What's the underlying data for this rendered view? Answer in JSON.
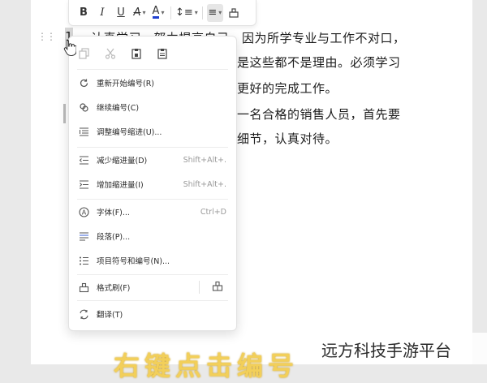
{
  "toolbar": {
    "items": [
      {
        "icon": "bold-icon",
        "glyph": "B"
      },
      {
        "icon": "italic-icon",
        "glyph": "I"
      },
      {
        "icon": "underline-icon",
        "glyph": "U"
      },
      {
        "icon": "highlight-icon",
        "glyph": "A"
      },
      {
        "icon": "font-color-icon",
        "glyph": "A"
      },
      {
        "icon": "line-spacing-icon",
        "glyph": "≡"
      },
      {
        "icon": "align-icon",
        "glyph": "≡"
      },
      {
        "icon": "format-painter-icon",
        "glyph": "⌂"
      }
    ],
    "font_color": "#1f3fcf"
  },
  "document": {
    "list_number": "1.",
    "lines": [
      "认真学习，努力提高自己，因为所学专业与工作不对口，",
      "是这些都不是理由。必须学习",
      "更好的完成工作。",
      "一名合格的销售人员，首先要",
      "细节，认真对待。"
    ]
  },
  "context_menu": {
    "items": [
      {
        "label": "重新开始编号(R)",
        "icon": "restart-numbering-icon",
        "shortcut": ""
      },
      {
        "label": "继续编号(C)",
        "icon": "continue-numbering-icon",
        "shortcut": ""
      },
      {
        "label": "调整编号缩进(U)...",
        "icon": "adjust-indent-icon",
        "shortcut": ""
      },
      {
        "label": "减少缩进量(D)",
        "icon": "decrease-indent-icon",
        "shortcut": "Shift+Alt+."
      },
      {
        "label": "增加缩进量(I)",
        "icon": "increase-indent-icon",
        "shortcut": "Shift+Alt+."
      },
      {
        "label": "字体(F)...",
        "icon": "font-icon",
        "shortcut": "Ctrl+D"
      },
      {
        "label": "段落(P)...",
        "icon": "paragraph-icon",
        "shortcut": ""
      },
      {
        "label": "项目符号和编号(N)...",
        "icon": "bullets-numbering-icon",
        "shortcut": ""
      },
      {
        "label": "格式刷(F)",
        "icon": "format-painter-icon",
        "shortcut": ""
      },
      {
        "label": "翻译(T)",
        "icon": "translate-icon",
        "shortcut": ""
      }
    ]
  },
  "watermark": "远方科技手游平台",
  "banner_text": "右键点击编号"
}
